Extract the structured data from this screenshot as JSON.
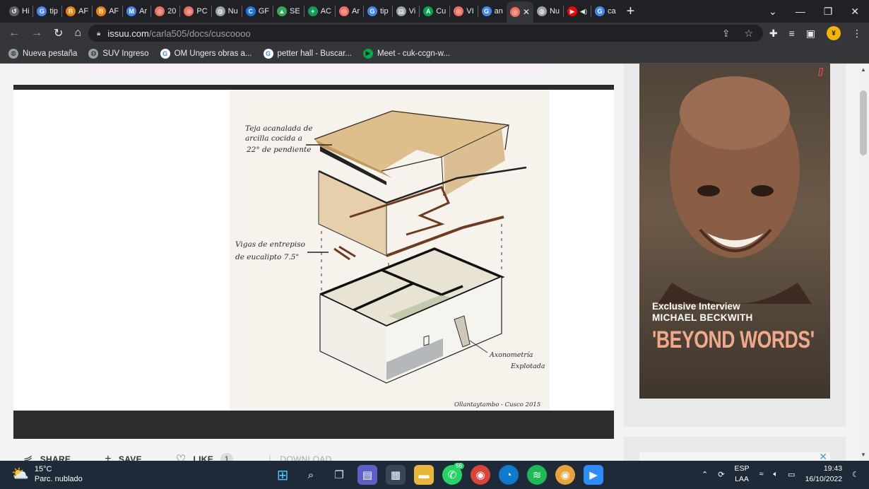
{
  "tabs": [
    {
      "label": "Hi",
      "icon": "history-icon",
      "color": "#5f6368"
    },
    {
      "label": "tip",
      "icon": "google-icon",
      "color": "#4285f4"
    },
    {
      "label": "AF",
      "icon": "blogger-icon",
      "color": "#f57d00"
    },
    {
      "label": "AF",
      "icon": "blogger-icon",
      "color": "#f57d00"
    },
    {
      "label": "Ar",
      "icon": "gmail-icon",
      "color": "#4285f4"
    },
    {
      "label": "20",
      "icon": "issuu-icon",
      "color": "#f36d5d"
    },
    {
      "label": "PC",
      "icon": "issuu-icon",
      "color": "#f36d5d"
    },
    {
      "label": "Nu",
      "icon": "chrome-icon",
      "color": "#9aa0a6"
    },
    {
      "label": "GF",
      "icon": "chatgpt-icon",
      "color": "#1a73e8"
    },
    {
      "label": "SE",
      "icon": "drive-icon",
      "color": "#34a853"
    },
    {
      "label": "AC",
      "icon": "sheets-icon",
      "color": "#0f9d58"
    },
    {
      "label": "Ar",
      "icon": "issuu-icon",
      "color": "#f36d5d"
    },
    {
      "label": "tip",
      "icon": "google-icon",
      "color": "#4285f4"
    },
    {
      "label": "Vi",
      "icon": "doc-icon",
      "color": "#9aa0a6"
    },
    {
      "label": "Cu",
      "icon": "archdaily-icon",
      "color": "#00a651"
    },
    {
      "label": "VI",
      "icon": "issuu-icon",
      "color": "#f36d5d"
    },
    {
      "label": "an",
      "icon": "google-icon",
      "color": "#4285f4"
    },
    {
      "label": "",
      "icon": "issuu-icon",
      "color": "#f36d5d",
      "active": true
    },
    {
      "label": "Nu",
      "icon": "chrome-icon",
      "color": "#9aa0a6"
    },
    {
      "label": "",
      "icon": "youtube-icon",
      "color": "#ff0000"
    },
    {
      "label": "ca",
      "icon": "google-icon",
      "color": "#4285f4"
    }
  ],
  "address": {
    "host": "issuu.com",
    "path": "/carla505/docs/cuscoooo"
  },
  "bookmarks": [
    {
      "label": "Nueva pestaña",
      "icon": "globe-icon"
    },
    {
      "label": "SUV Ingreso",
      "icon": "globe-icon"
    },
    {
      "label": "OM Ungers obras a...",
      "icon": "google-icon"
    },
    {
      "label": "petter hall - Buscar...",
      "icon": "google-icon"
    },
    {
      "label": "Meet - cuk-ccgn-w...",
      "icon": "meet-icon"
    }
  ],
  "sketch": {
    "note1_line1": "Teja acanalada de",
    "note1_line2": "arcilla cocida a",
    "note1_line3": "22° de pendiente",
    "note2_line1": "Vigas de entrepiso",
    "note2_line2": "de eucalipto 7.5\"",
    "title_line1": "Axonometría",
    "title_line2": "Explotada",
    "signature": "Ollantaytambo - Cusco 2015"
  },
  "actions": {
    "share": "SHARE",
    "save": "SAVE",
    "like": "LIKE",
    "like_count": "1",
    "download": "DOWNLOAD"
  },
  "ad": {
    "close": "[]",
    "line1": "Exclusive Interview",
    "line2": "MICHAEL BECKWITH",
    "line3": "'BEYOND WORDS'"
  },
  "taskbar": {
    "temp": "15°C",
    "weather": "Parc. nublado",
    "whatsapp_badge": "56",
    "lang1": "ESP",
    "lang2": "LAA",
    "time": "19:43",
    "date": "16/10/2022"
  },
  "colors": {
    "accent_issuu": "#f36d5d",
    "ad_text_accent": "#f0a98b",
    "taskbar_bg": "#1f2a38"
  }
}
